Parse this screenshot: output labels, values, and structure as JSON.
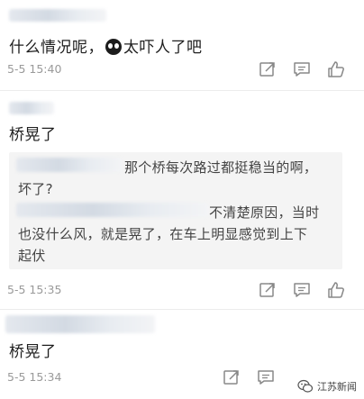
{
  "comments": [
    {
      "text_before_emoji": "什么情况呢，",
      "text_after_emoji": "太吓人了吧",
      "time": "5-5 15:40",
      "emoji": "face-emoji"
    },
    {
      "text": "桥晃了",
      "quote_line1": "那个桥每次路过都挺稳当的啊，",
      "quote_line2": "坏了?",
      "quote_line3": "不清楚原因，当时",
      "quote_line4": "也没什么风，就是晃了，在车上明显感觉到上下",
      "quote_line5": "起伏",
      "time": "5-5 15:35"
    },
    {
      "text": "桥晃了",
      "time": "5-5 15:34"
    }
  ],
  "icons": [
    "share-icon",
    "reply-icon",
    "like-icon"
  ],
  "watermark": {
    "text": "江苏新闻",
    "icon": "wechat-icon"
  },
  "colors": {
    "time": "#9a9a9a",
    "quote_bg": "#f4f4f4",
    "divider": "#ececec"
  }
}
